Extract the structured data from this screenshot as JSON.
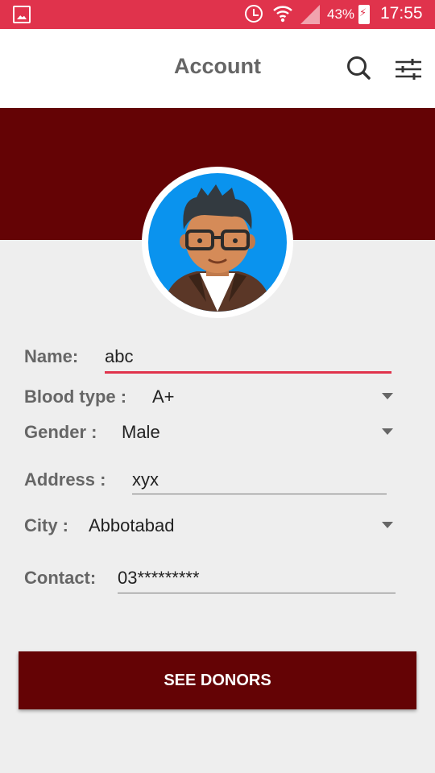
{
  "status_bar": {
    "battery_percent": "43%",
    "time": "17:55",
    "color": "#e0334c"
  },
  "app_bar": {
    "title": "Account",
    "icons": [
      "search-icon",
      "filter-icon"
    ]
  },
  "theme": {
    "primary": "#640305",
    "accent": "#e0334c",
    "avatar_bg": "#0a93ee"
  },
  "form": {
    "name": {
      "label": "Name:",
      "value": "abc"
    },
    "blood_type": {
      "label": "Blood type :",
      "value": "A+"
    },
    "gender": {
      "label": "Gender :",
      "value": "Male"
    },
    "address": {
      "label": "Address :",
      "value": "xyx"
    },
    "city": {
      "label": "City :",
      "value": "Abbotabad"
    },
    "contact": {
      "label": "Contact:",
      "value": "03*********"
    }
  },
  "action": {
    "label": "SEE DONORS"
  }
}
